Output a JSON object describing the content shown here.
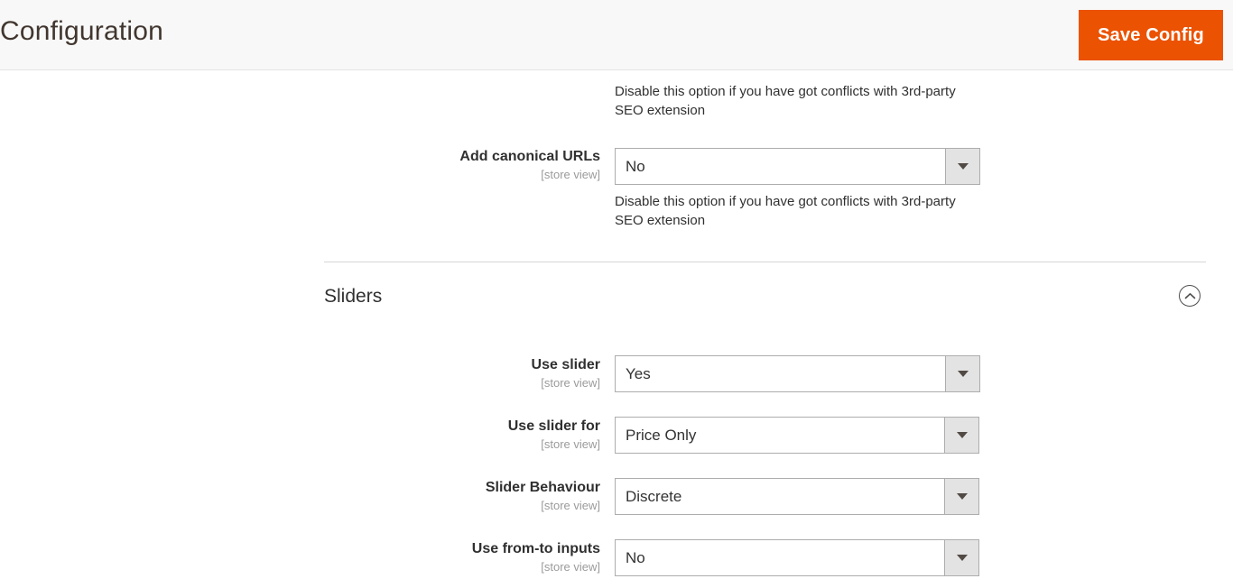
{
  "header": {
    "title": "Configuration",
    "save_label": "Save Config"
  },
  "top_section": {
    "leading_help_text": "Disable this option if you have got conflicts with 3rd-party SEO extension",
    "fields": [
      {
        "label": "Add canonical URLs",
        "scope": "[store view]",
        "value": "No",
        "help": "Disable this option if you have got conflicts with 3rd-party SEO extension"
      }
    ]
  },
  "sliders_section": {
    "title": "Sliders",
    "collapse_icon": "chevron-up-circle-icon",
    "fields": [
      {
        "label": "Use slider",
        "scope": "[store view]",
        "value": "Yes"
      },
      {
        "label": "Use slider for",
        "scope": "[store view]",
        "value": "Price Only"
      },
      {
        "label": "Slider Behaviour",
        "scope": "[store view]",
        "value": "Discrete"
      },
      {
        "label": "Use from-to inputs",
        "scope": "[store view]",
        "value": "No"
      }
    ]
  },
  "colors": {
    "accent_orange": "#eb5202",
    "header_bg": "#f8f8f8",
    "label_text": "#303030",
    "scope_text": "#9b9b9b",
    "select_arrow_bg": "#e3e3e3"
  }
}
